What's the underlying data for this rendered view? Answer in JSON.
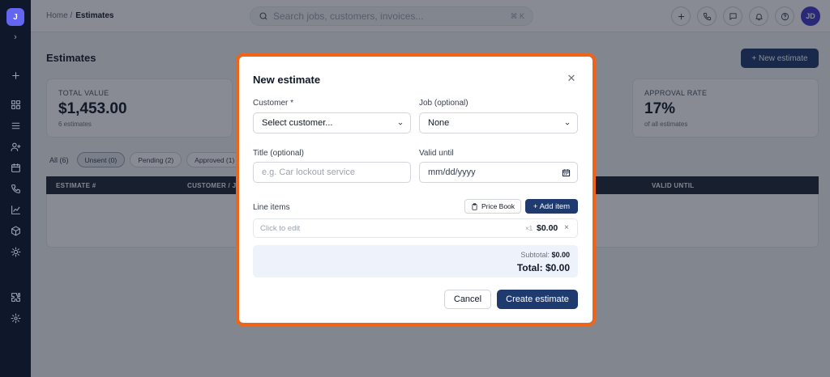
{
  "sidebar": {
    "logo_letter": "J",
    "collapse_icon": "chevron-right-icon",
    "items": [
      "plus-icon",
      "grid-icon",
      "list-icon",
      "user-plus-icon",
      "calendar-icon",
      "phone-icon",
      "chart-icon",
      "box-icon",
      "sun-icon",
      "puzzle-icon",
      "gear-icon"
    ]
  },
  "topbar": {
    "breadcrumb_home": "Home /",
    "breadcrumb_current": "Estimates",
    "search_placeholder": "Search jobs, customers, invoices...",
    "search_shortcut": "⌘ K",
    "avatar_initials": "JD"
  },
  "page": {
    "title": "Estimates",
    "new_button": "+ New estimate",
    "stats": [
      {
        "label": "TOTAL VALUE",
        "value": "$1,453.00",
        "sub": "6 estimates"
      },
      {
        "label": "APPROVAL RATE",
        "value": "17%",
        "sub": "of all estimates"
      }
    ],
    "filters": {
      "all": "All (6)",
      "unsent": "Unsent (0)",
      "pending": "Pending (2)",
      "approved": "Approved (1)"
    },
    "table_headers": {
      "number": "ESTIMATE #",
      "customer": "CUSTOMER / JO",
      "valid_until": "VALID UNTIL"
    }
  },
  "modal": {
    "title": "New estimate",
    "customer_label": "Customer *",
    "customer_value": "Select customer...",
    "job_label": "Job (optional)",
    "job_value": "None",
    "title_label": "Title (optional)",
    "title_placeholder": "e.g. Car lockout service",
    "valid_label": "Valid until",
    "valid_placeholder": "mm/dd/yyyy",
    "line_items_label": "Line items",
    "price_book_label": "Price Book",
    "add_item_label": "+ Add item",
    "line_item": {
      "description": "Click to edit",
      "qty": "×1",
      "amount": "$0.00",
      "remove": "×"
    },
    "subtotal_label": "Subtotal:",
    "subtotal_value": "$0.00",
    "total_text": "Total: $0.00",
    "cancel_label": "Cancel",
    "create_label": "Create estimate"
  },
  "colors": {
    "navy": "#1e3a6e",
    "highlight": "#f06418",
    "sidebar": "#0f172a"
  }
}
